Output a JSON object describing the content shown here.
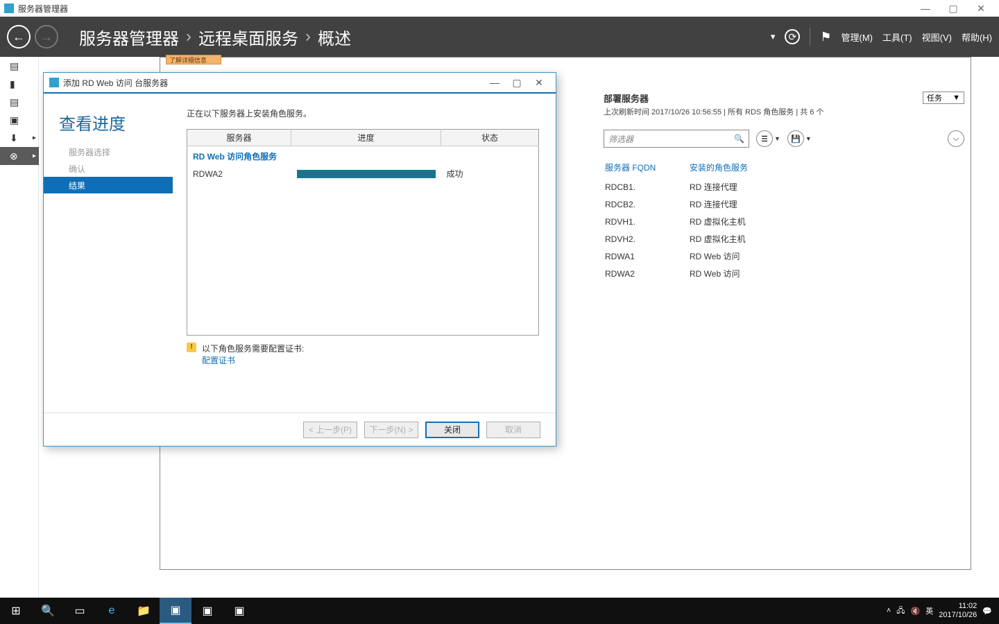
{
  "window": {
    "app_title": "服务器管理器",
    "minimize": "—",
    "maximize": "▢",
    "close": "✕"
  },
  "navbar": {
    "crumbs": [
      "服务器管理器",
      "远程桌面服务",
      "概述"
    ],
    "menu": {
      "manage": "管理(M)",
      "tools": "工具(T)",
      "view": "视图(V)",
      "help": "帮助(H)"
    },
    "dropdown": "▾",
    "refresh": "⟳",
    "flag": "⚑"
  },
  "sidebar_icons": [
    "▤",
    "▮",
    "▤",
    "▣",
    "⬇",
    "⊗"
  ],
  "yellowbar": "了解详细信息",
  "deploy": {
    "title": "部署服务器",
    "subtitle": "上次刷新时间 2017/10/26 10:56:55 | 所有 RDS 角色服务  | 共 6 个",
    "tasks_label": "任务",
    "filter_placeholder": "筛选器",
    "col_fqdn": "服务器 FQDN",
    "col_role": "安装的角色服务",
    "rows": [
      {
        "fqdn": "RDCB1.",
        "role": "RD 连接代理"
      },
      {
        "fqdn": "RDCB2.",
        "role": "RD 连接代理"
      },
      {
        "fqdn": "RDVH1.",
        "role": "RD 虚拟化主机"
      },
      {
        "fqdn": "RDVH2.",
        "role": "RD 虚拟化主机"
      },
      {
        "fqdn": "RDWA1",
        "role": "RD Web 访问"
      },
      {
        "fqdn": "RDWA2",
        "role": "RD Web 访问"
      }
    ]
  },
  "wizard": {
    "title": "添加 RD Web 访问 台服务器",
    "heading": "查看进度",
    "steps": {
      "server_select": "服务器选择",
      "confirm": "确认",
      "result": "结果"
    },
    "desc": "正在以下服务器上安装角色服务。",
    "cols": {
      "server": "服务器",
      "progress": "进度",
      "status": "状态"
    },
    "group": "RD Web 访问角色服务",
    "row_server": "RDWA2",
    "row_status": "成功",
    "warn_text": "以下角色服务需要配置证书:",
    "cert_link": "配置证书",
    "buttons": {
      "prev": "< 上一步(P)",
      "next": "下一步(N) >",
      "close": "关闭",
      "cancel": "取消"
    }
  },
  "taskbar": {
    "ime": "英",
    "time": "11:02",
    "date": "2017/10/26"
  }
}
